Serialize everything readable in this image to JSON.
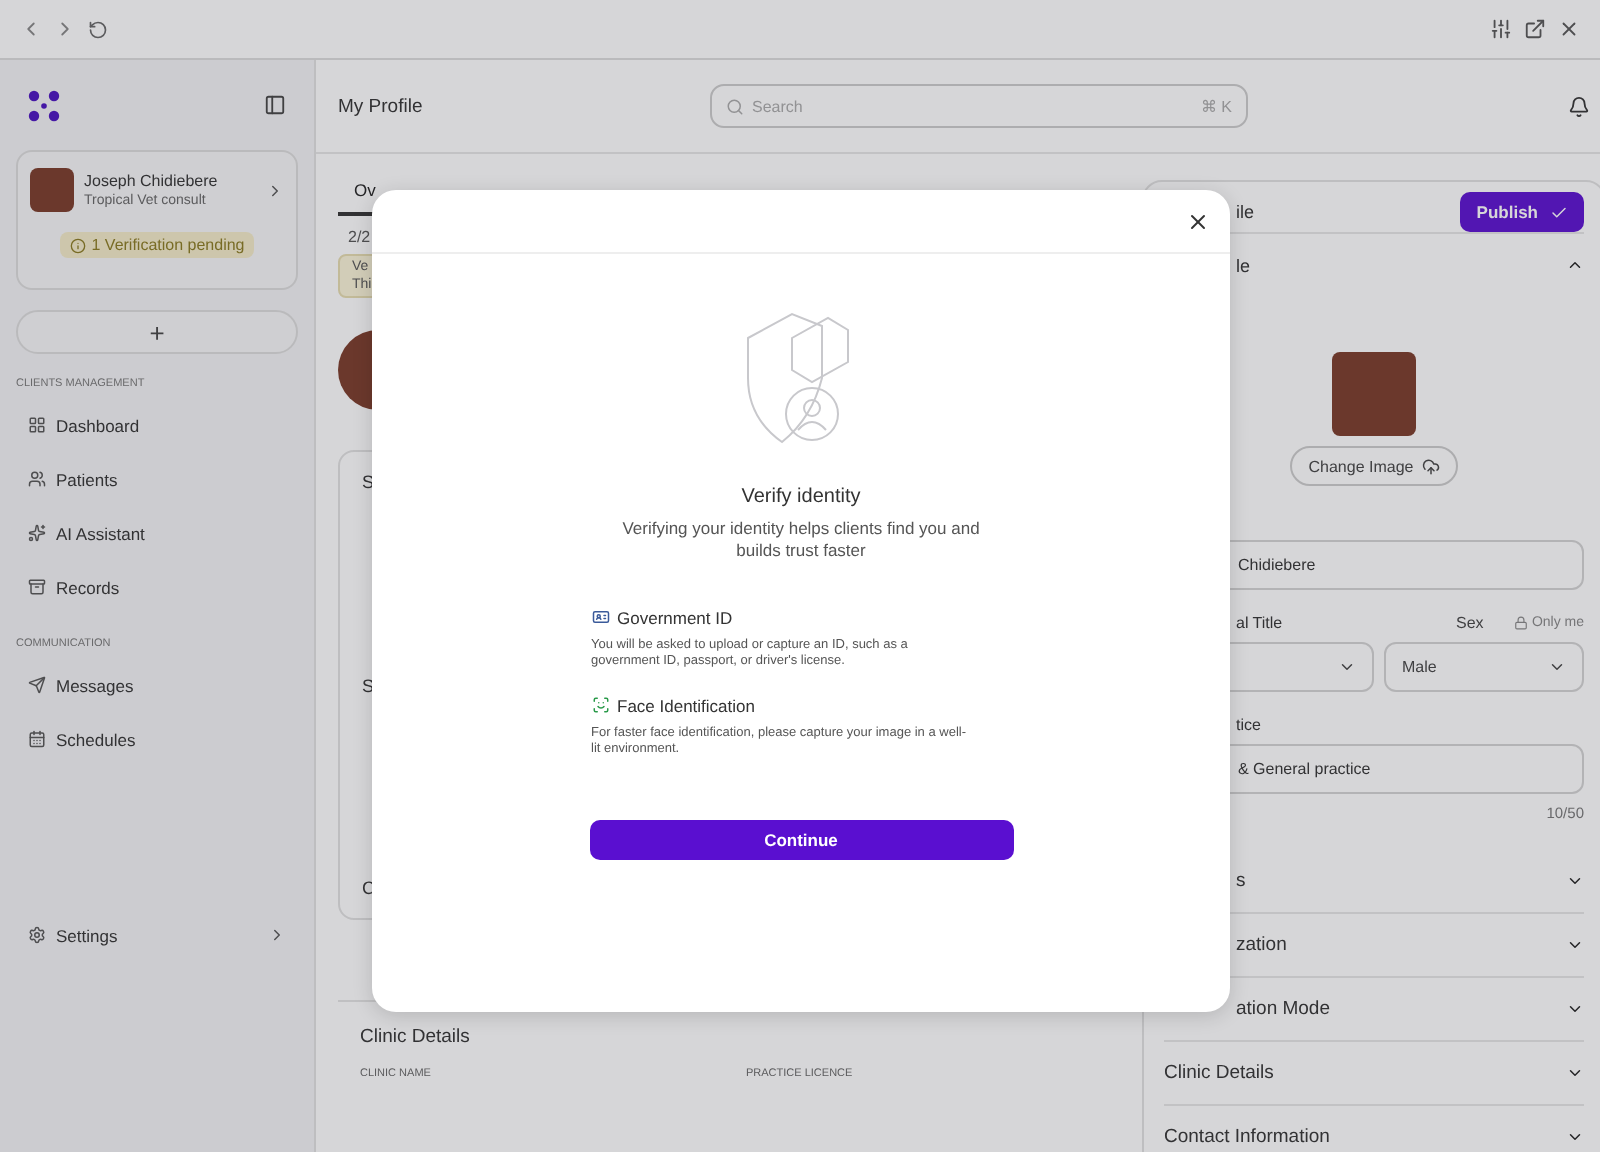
{
  "sidebar": {
    "profile": {
      "name": "Joseph Chidiebere",
      "subtitle": "Tropical Vet consult"
    },
    "verification": "1 Verification pending",
    "add_button": "+",
    "sections": [
      {
        "title": "CLIENTS MANAGEMENT",
        "items": [
          {
            "label": "Dashboard"
          },
          {
            "label": "Patients"
          },
          {
            "label": "AI Assistant"
          },
          {
            "label": "Records"
          }
        ]
      },
      {
        "title": "COMMUNICATION",
        "items": [
          {
            "label": "Messages"
          },
          {
            "label": "Schedules"
          }
        ]
      }
    ],
    "settings": "Settings"
  },
  "header": {
    "title": "My Profile",
    "search": {
      "placeholder": "Search",
      "shortcut": "⌘ K"
    }
  },
  "overview": {
    "tab": "Ov",
    "progress": "2/2",
    "notice": [
      "Ve",
      "Thi"
    ],
    "cards": [
      "S",
      "S",
      "C"
    ],
    "clinic": {
      "title": "Clinic Details",
      "columns": [
        "CLINIC NAME",
        "PRACTICE LICENCE"
      ]
    }
  },
  "profile_panel": {
    "title": "ile",
    "publish": "Publish",
    "section": {
      "label": "le",
      "expanded": true
    },
    "change_image": "Change Image",
    "name_value": "Chidiebere",
    "labels": [
      "al Title",
      "Sex"
    ],
    "privacy": "Only me",
    "sex_value": "Male",
    "practice_label": "tice",
    "practice_value": "& General practice",
    "counter": "10/50",
    "sections": [
      {
        "label": "s",
        "expanded": false
      },
      {
        "label": "zation",
        "expanded": false
      },
      {
        "label": "ation Mode",
        "expanded": false
      },
      {
        "label": "Clinic Details",
        "expanded": false
      },
      {
        "label": "Contact Information",
        "expanded": false
      }
    ]
  },
  "modal": {
    "title": "Verify identity",
    "subtitle": "Verifying your identity helps clients find you and builds trust faster",
    "options": [
      {
        "kind": "id",
        "title": "Government ID",
        "description": "You will be asked to upload or capture an ID, such as a government ID, passport, or driver's license."
      },
      {
        "kind": "face",
        "title": "Face Identification",
        "description": "For faster face identification, please capture your image in a well-lit environment."
      }
    ],
    "button": "Continue"
  }
}
